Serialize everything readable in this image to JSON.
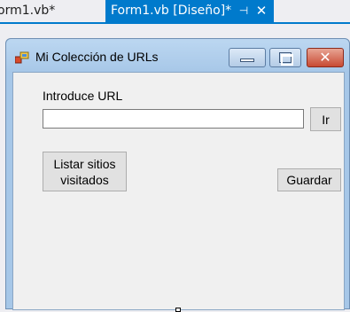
{
  "ide": {
    "tabs": [
      {
        "label": "orm1.vb*",
        "active": false
      },
      {
        "label": "Form1.vb [Diseño]*",
        "active": true
      }
    ],
    "pin_glyph": "⊣",
    "close_glyph": "✕",
    "accent_color": "#007acc"
  },
  "form": {
    "title": "Mi Colección de URLs",
    "icon": "app-icon",
    "caption_buttons": {
      "minimize": "minimize-icon",
      "maximize": "maximize-icon",
      "close": "close-icon",
      "close_glyph": "✕"
    },
    "url_label": "Introduce URL",
    "url_value": "",
    "go_button": "Ir",
    "list_button": "Listar sitios visitados",
    "save_button": "Guardar"
  }
}
